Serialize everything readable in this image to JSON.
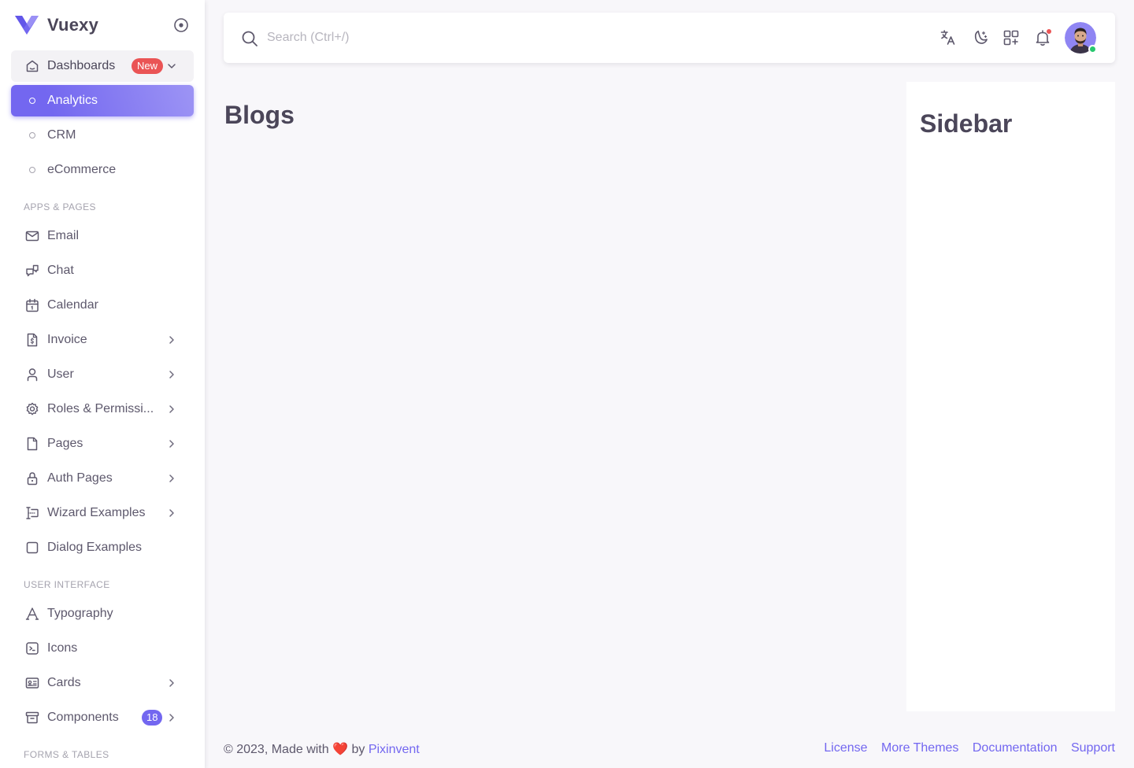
{
  "brand": {
    "name": "Vuexy",
    "logo_color": "#7367f0"
  },
  "sidebar": {
    "dashboards": {
      "label": "Dashboards",
      "badge": "New",
      "icon": "smart-home-icon"
    },
    "dashboard_children": [
      {
        "label": "Analytics",
        "active": true
      },
      {
        "label": "CRM"
      },
      {
        "label": "eCommerce"
      }
    ],
    "section_apps": "APPS & PAGES",
    "apps_items": [
      {
        "label": "Email",
        "icon": "mail-icon"
      },
      {
        "label": "Chat",
        "icon": "messages-icon"
      },
      {
        "label": "Calendar",
        "icon": "calendar-icon"
      },
      {
        "label": "Invoice",
        "icon": "file-dollar-icon"
      },
      {
        "label": "User",
        "icon": "user-icon"
      },
      {
        "label": "Roles & Permissi...",
        "icon": "settings-icon"
      },
      {
        "label": "Pages",
        "icon": "file-icon"
      },
      {
        "label": "Auth Pages",
        "icon": "lock-icon"
      },
      {
        "label": "Wizard Examples",
        "icon": "forms-icon"
      },
      {
        "label": "Dialog Examples",
        "icon": "square-icon"
      }
    ],
    "section_ui": "USER INTERFACE",
    "ui_items": [
      {
        "label": "Typography",
        "icon": "typography-icon"
      },
      {
        "label": "Icons",
        "icon": "terminal-icon"
      },
      {
        "label": "Cards",
        "icon": "id-card-icon"
      },
      {
        "label": "Components",
        "icon": "archive-icon",
        "badge": "18"
      }
    ],
    "section_forms": "FORMS & TABLES"
  },
  "navbar": {
    "search_placeholder": "Search (Ctrl+/)",
    "icons": [
      "language-icon",
      "moon-icon",
      "shortcuts-icon",
      "bell-icon"
    ],
    "notification_color": "#ea5455",
    "online_color": "#28c76f"
  },
  "main": {
    "title": "Blogs"
  },
  "side_panel": {
    "title": "Sidebar"
  },
  "footer": {
    "copyright_pre": "© 2023, Made with",
    "heart": "❤️",
    "by": "by",
    "company": "Pixinvent",
    "links": [
      "License",
      "More Themes",
      "Documentation",
      "Support"
    ]
  },
  "colors": {
    "primary": "#7367f0",
    "body_bg": "#f8f7fa",
    "text": "#5d586c"
  }
}
